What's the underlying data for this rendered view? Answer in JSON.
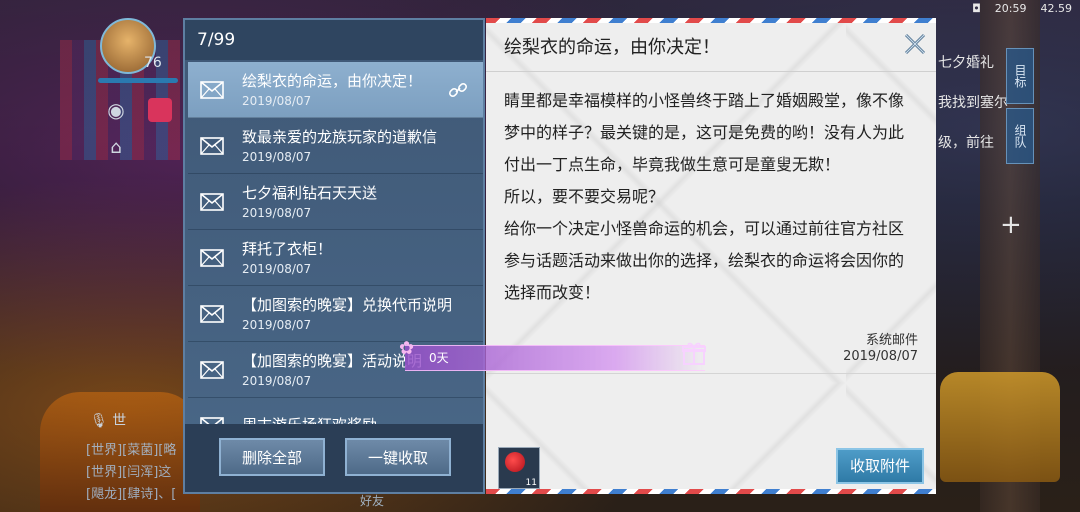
{
  "status_bar": {
    "time": "20:59",
    "battery": "42.59"
  },
  "hud": {
    "level": "76",
    "right_lines": [
      "七夕婚礼",
      "我找到塞尔",
      "级，前往"
    ],
    "side_buttons": [
      "目标",
      "组队"
    ]
  },
  "chat": {
    "channel_tab": "世",
    "lines": [
      "[世界][菜菌][略",
      "[世界][闫浑]这",
      "[飓龙][肆诗]、["
    ],
    "footer": "好友"
  },
  "mail_list": {
    "counter": "7/99",
    "items": [
      {
        "subject": "绘梨衣的命运，由你决定！",
        "date": "2019/08/07",
        "selected": true
      },
      {
        "subject": "致最亲爱的龙族玩家的道歉信",
        "date": "2019/08/07"
      },
      {
        "subject": "七夕福利钻石天天送",
        "date": "2019/08/07"
      },
      {
        "subject": "拜托了衣柜！",
        "date": "2019/08/07"
      },
      {
        "subject": "【加图索的晚宴】兑换代币说明",
        "date": "2019/08/07"
      },
      {
        "subject": "【加图索的晚宴】活动说明",
        "date": "2019/08/07"
      },
      {
        "subject": "周末游乐场狂欢奖励",
        "date": ""
      }
    ],
    "delete_all_label": "删除全部",
    "claim_all_label": "一键收取"
  },
  "mail_detail": {
    "title": "绘梨衣的命运，由你决定！",
    "paragraphs": [
      "睛里都是幸福模样的小怪兽终于踏上了婚姻殿堂，像不像梦中的样子？最关键的是，这可是免费的哟！没有人为此付出一丁点生命，毕竟我做生意可是童叟无欺！",
      "所以，要不要交易呢？",
      "给你一个决定小怪兽命运的机会，可以通过前往官方社区参与话题活动来做出你的选择，绘梨衣的命运将会因你的选择而改变！"
    ],
    "sender": "系统邮件",
    "date": "2019/08/07",
    "attachment_count": "11",
    "claim_attachment_label": "收取附件"
  },
  "overlay_banner": {
    "text": "0天"
  },
  "colors": {
    "accent": "#2f7aa6",
    "list_bg": "#4a6888",
    "selected": "#8eb0cf"
  }
}
